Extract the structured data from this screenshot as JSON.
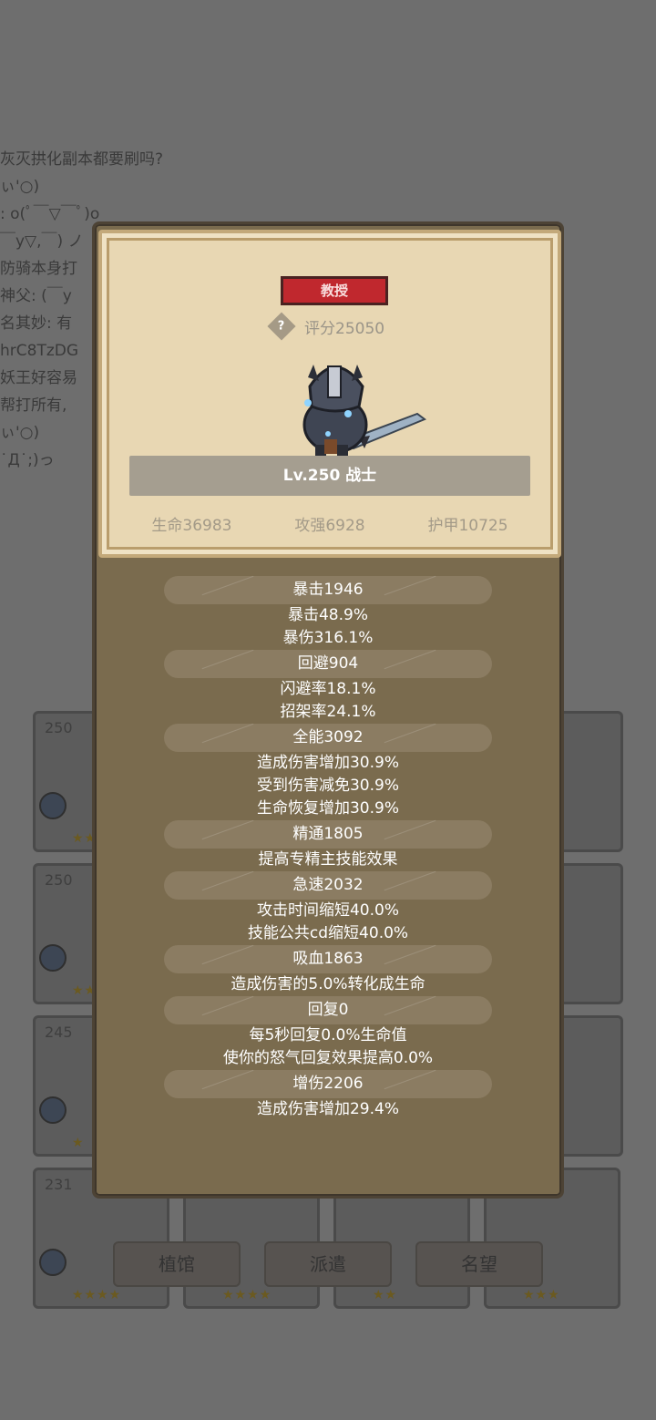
{
  "background": {
    "chat_lines": [
      "灰灭拱化副本都要刷吗?",
      "ぃ'○)",
      ": o(ﾟ￣▽￣ﾟ)o",
      "￣y▽,￣) ノ",
      "防骑本身打",
      "神父: (￣y",
      "名其妙: 有",
      "hrC8TzDG",
      "妖王好容易",
      "帮打所有, ",
      "ぃ'○)",
      " ˙Д˙;)っ"
    ],
    "cards": [
      {
        "level": "250",
        "stars": "★★"
      },
      {
        "level": "250",
        "stars": "★★"
      },
      {
        "level": "245",
        "stars": "★"
      },
      {
        "level": "231",
        "stars": "★★★★"
      }
    ],
    "bottom_cards_stars": [
      "★★★★",
      "★★",
      "★★★"
    ],
    "tabs": [
      "植馆",
      "派遣",
      "名望"
    ]
  },
  "hero": {
    "title": "教授",
    "score": "评分25050",
    "name": "Lv.250 战士",
    "stats": [
      "生命36983",
      "攻强6928",
      "护甲10725"
    ]
  },
  "attributes": [
    {
      "head": "暴击1946",
      "lines": [
        "暴击48.9%",
        "暴伤316.1%"
      ]
    },
    {
      "head": "回避904",
      "lines": [
        "闪避率18.1%",
        "招架率24.1%"
      ]
    },
    {
      "head": "全能3092",
      "lines": [
        "造成伤害增加30.9%",
        "受到伤害减免30.9%",
        "生命恢复增加30.9%"
      ]
    },
    {
      "head": "精通1805",
      "lines": [
        "提高专精主技能效果"
      ]
    },
    {
      "head": "急速2032",
      "lines": [
        "攻击时间缩短40.0%",
        "技能公共cd缩短40.0%"
      ]
    },
    {
      "head": "吸血1863",
      "lines": [
        "造成伤害的5.0%转化成生命"
      ]
    },
    {
      "head": "回复0",
      "lines": [
        "每5秒回复0.0%生命值",
        "使你的怒气回复效果提高0.0%"
      ]
    },
    {
      "head": "增伤2206",
      "lines": [
        "造成伤害增加29.4%"
      ]
    }
  ],
  "colors": {
    "title_badge": "#c0282e",
    "panel": "#7a6b4e",
    "card": "#e8d7b3"
  }
}
